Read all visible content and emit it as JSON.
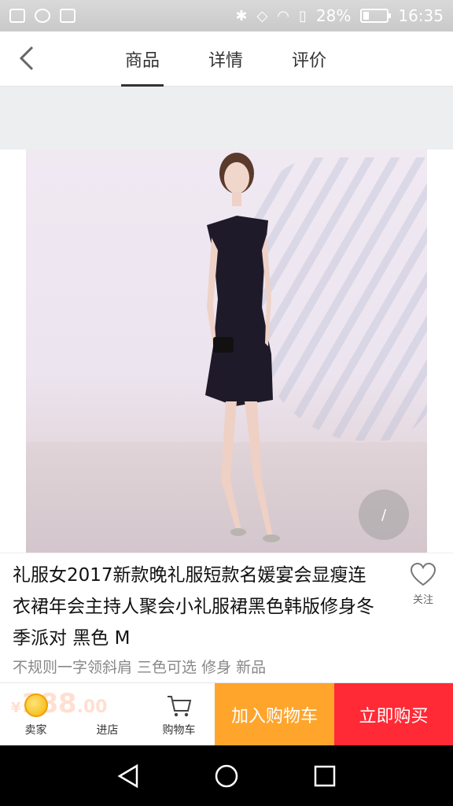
{
  "status_bar": {
    "battery": "28%",
    "time": "16:35"
  },
  "header": {
    "tabs": [
      {
        "label": "商品",
        "active": true
      },
      {
        "label": "详情",
        "active": false
      },
      {
        "label": "评价",
        "active": false
      }
    ]
  },
  "product": {
    "image_indicator": "/",
    "title": "礼服女2017新款晚礼服短款名媛宴会显瘦连衣裙年会主持人聚会小礼服裙黑色韩版修身冬季派对 黑色 M",
    "subtitle": "不规则一字领斜肩 三色可选 修身 新品",
    "follow_label": "关注",
    "price_ghost": {
      "currency": "¥",
      "integer": "188",
      "cents": ".00"
    }
  },
  "action_bar": {
    "seller_label": "卖家",
    "shop_label": "进店",
    "cart_label": "购物车",
    "add_to_cart": "加入购物车",
    "buy_now": "立即购买"
  },
  "colors": {
    "add_to_cart_bg": "#ffa52c",
    "buy_now_bg": "#ff2a36"
  }
}
